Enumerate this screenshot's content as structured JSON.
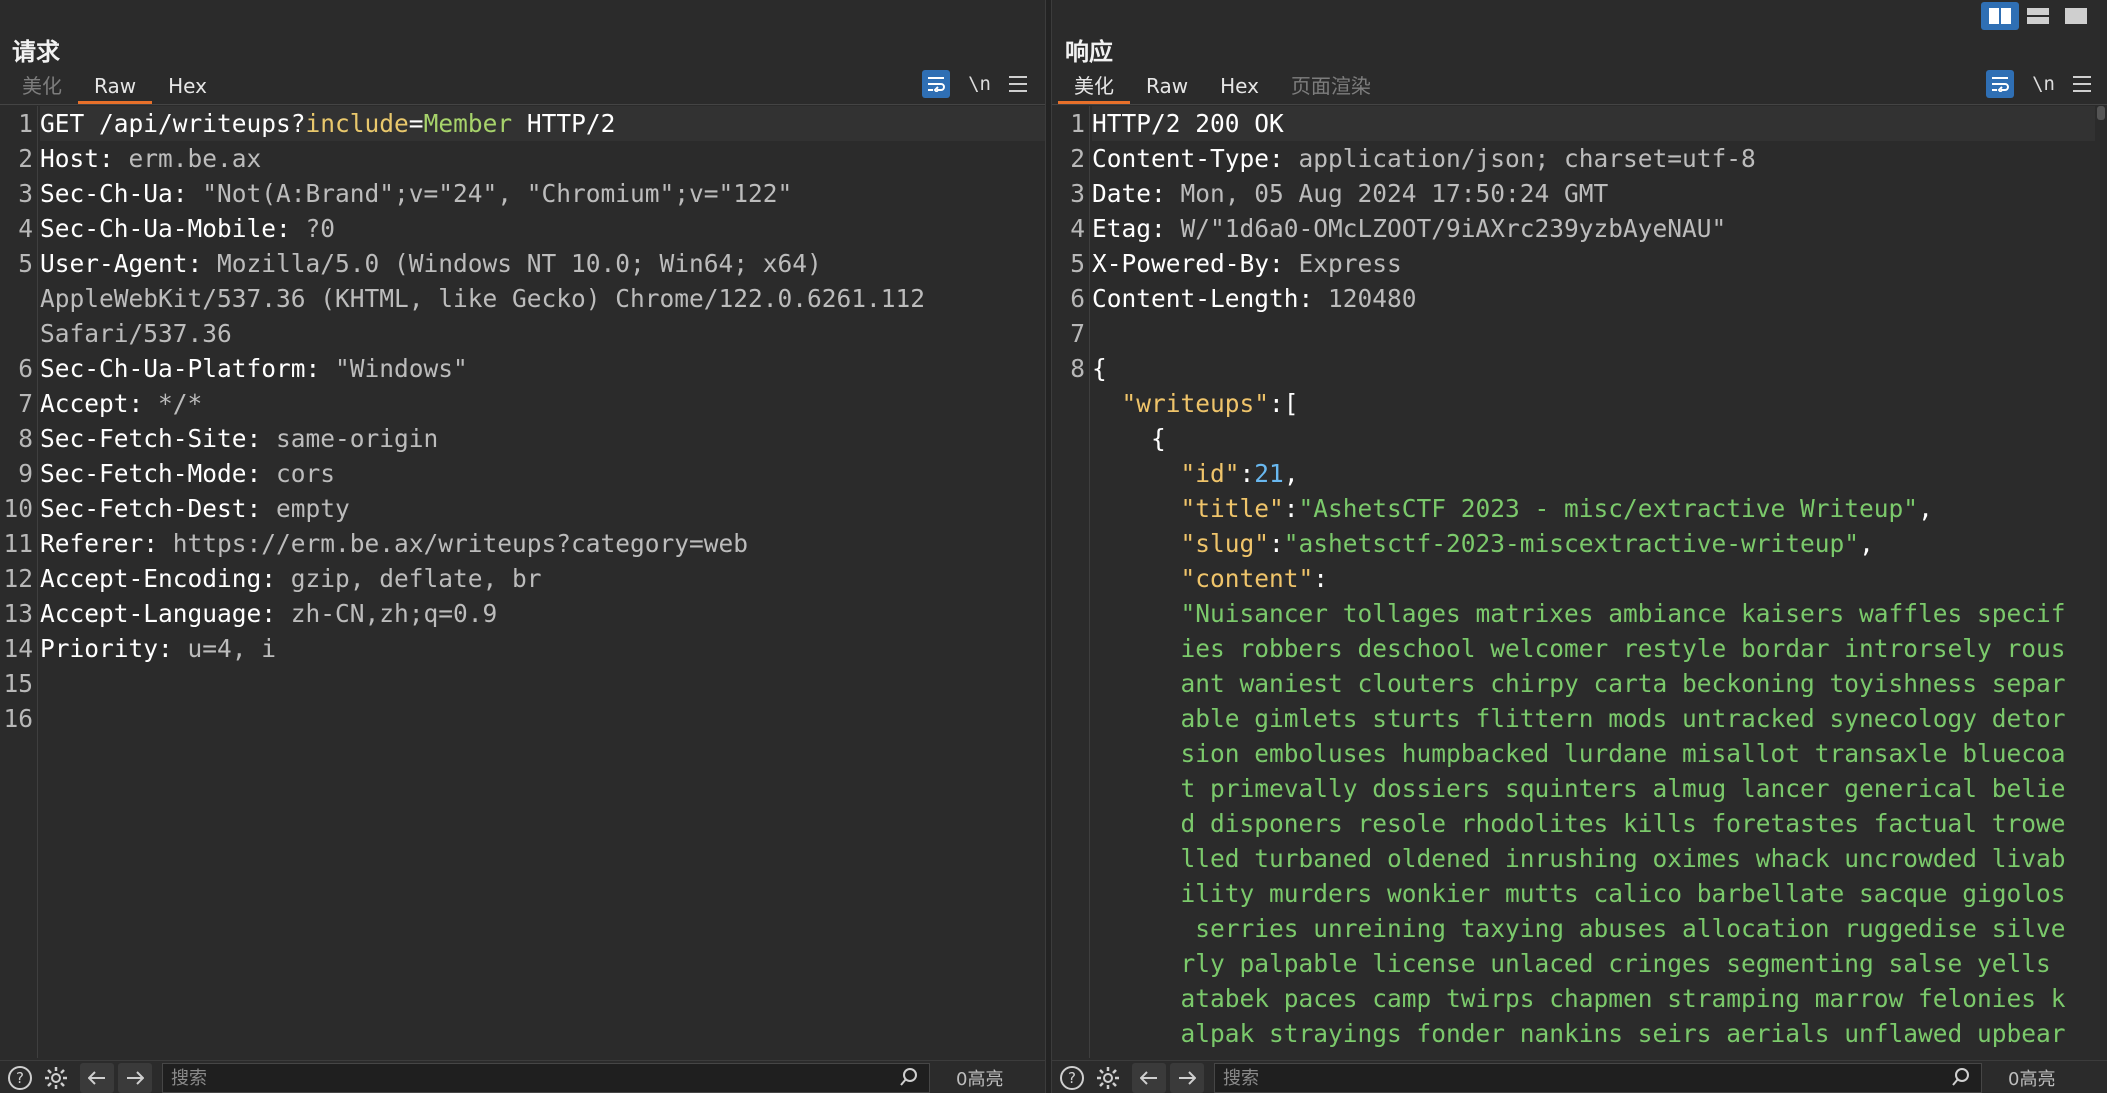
{
  "request": {
    "title": "请求",
    "tabs": [
      "美化",
      "Raw",
      "Hex"
    ],
    "active_tab": "Raw",
    "newline_toggle": "\\n",
    "lines": [
      {
        "n": "1",
        "parts": [
          [
            "k",
            "GET "
          ],
          [
            "k",
            "/api/writeups?"
          ],
          [
            "p",
            "include"
          ],
          [
            "k",
            "="
          ],
          [
            "g",
            "Member"
          ],
          [
            "k",
            " HTTP/2"
          ]
        ]
      },
      {
        "n": "2",
        "parts": [
          [
            "k",
            "Host: "
          ],
          [
            "v",
            "erm.be.ax"
          ]
        ]
      },
      {
        "n": "3",
        "parts": [
          [
            "k",
            "Sec-Ch-Ua: "
          ],
          [
            "v",
            "\"Not(A:Brand\";v=\"24\", \"Chromium\";v=\"122\""
          ]
        ]
      },
      {
        "n": "4",
        "parts": [
          [
            "k",
            "Sec-Ch-Ua-Mobile: "
          ],
          [
            "v",
            "?0"
          ]
        ]
      },
      {
        "n": "5",
        "parts": [
          [
            "k",
            "User-Agent: "
          ],
          [
            "v",
            "Mozilla/5.0 (Windows NT 10.0; Win64; x64)"
          ]
        ]
      },
      {
        "n": "",
        "parts": [
          [
            "v",
            "AppleWebKit/537.36 (KHTML, like Gecko) Chrome/122.0.6261.112"
          ]
        ]
      },
      {
        "n": "",
        "parts": [
          [
            "v",
            "Safari/537.36"
          ]
        ]
      },
      {
        "n": "6",
        "parts": [
          [
            "k",
            "Sec-Ch-Ua-Platform: "
          ],
          [
            "v",
            "\"Windows\""
          ]
        ]
      },
      {
        "n": "7",
        "parts": [
          [
            "k",
            "Accept: "
          ],
          [
            "v",
            "*/*"
          ]
        ]
      },
      {
        "n": "8",
        "parts": [
          [
            "k",
            "Sec-Fetch-Site: "
          ],
          [
            "v",
            "same-origin"
          ]
        ]
      },
      {
        "n": "9",
        "parts": [
          [
            "k",
            "Sec-Fetch-Mode: "
          ],
          [
            "v",
            "cors"
          ]
        ]
      },
      {
        "n": "10",
        "parts": [
          [
            "k",
            "Sec-Fetch-Dest: "
          ],
          [
            "v",
            "empty"
          ]
        ]
      },
      {
        "n": "11",
        "parts": [
          [
            "k",
            "Referer: "
          ],
          [
            "v",
            "https://erm.be.ax/writeups?category=web"
          ]
        ]
      },
      {
        "n": "12",
        "parts": [
          [
            "k",
            "Accept-Encoding: "
          ],
          [
            "v",
            "gzip, deflate, br"
          ]
        ]
      },
      {
        "n": "13",
        "parts": [
          [
            "k",
            "Accept-Language: "
          ],
          [
            "v",
            "zh-CN,zh;q=0.9"
          ]
        ]
      },
      {
        "n": "14",
        "parts": [
          [
            "k",
            "Priority: "
          ],
          [
            "v",
            "u=4, i"
          ]
        ]
      },
      {
        "n": "15",
        "parts": []
      },
      {
        "n": "16",
        "parts": []
      }
    ],
    "search_placeholder": "搜索",
    "highlight_count": "0高亮"
  },
  "response": {
    "title": "响应",
    "tabs": [
      "美化",
      "Raw",
      "Hex",
      "页面渲染"
    ],
    "active_tab": "美化",
    "newline_toggle": "\\n",
    "lines": [
      {
        "n": "1",
        "parts": [
          [
            "k",
            "HTTP/2 200 OK"
          ]
        ]
      },
      {
        "n": "2",
        "parts": [
          [
            "k",
            "Content-Type: "
          ],
          [
            "v",
            "application/json; charset=utf-8"
          ]
        ]
      },
      {
        "n": "3",
        "parts": [
          [
            "k",
            "Date: "
          ],
          [
            "v",
            "Mon, 05 Aug 2024 17:50:24 GMT"
          ]
        ]
      },
      {
        "n": "4",
        "parts": [
          [
            "k",
            "Etag: "
          ],
          [
            "v",
            "W/\"1d6a0-OMcLZOOT/9iAXrc239yzbAyeNAU\""
          ]
        ]
      },
      {
        "n": "5",
        "parts": [
          [
            "k",
            "X-Powered-By: "
          ],
          [
            "v",
            "Express"
          ]
        ]
      },
      {
        "n": "6",
        "parts": [
          [
            "k",
            "Content-Length: "
          ],
          [
            "v",
            "120480"
          ]
        ]
      },
      {
        "n": "7",
        "parts": []
      },
      {
        "n": "8",
        "parts": [
          [
            "k",
            "{"
          ]
        ]
      },
      {
        "n": "",
        "parts": [
          [
            "k",
            "  "
          ],
          [
            "jkey",
            "\"writeups\""
          ],
          [
            "k",
            ":["
          ]
        ]
      },
      {
        "n": "",
        "parts": [
          [
            "k",
            "    {"
          ]
        ]
      },
      {
        "n": "",
        "parts": [
          [
            "k",
            "      "
          ],
          [
            "jkey",
            "\"id\""
          ],
          [
            "k",
            ":"
          ],
          [
            "jnum",
            "21"
          ],
          [
            "k",
            ","
          ]
        ]
      },
      {
        "n": "",
        "parts": [
          [
            "k",
            "      "
          ],
          [
            "jkey",
            "\"title\""
          ],
          [
            "k",
            ":"
          ],
          [
            "jstr",
            "\"AshetsCTF 2023 - misc/extractive Writeup\""
          ],
          [
            "k",
            ","
          ]
        ]
      },
      {
        "n": "",
        "parts": [
          [
            "k",
            "      "
          ],
          [
            "jkey",
            "\"slug\""
          ],
          [
            "k",
            ":"
          ],
          [
            "jstr",
            "\"ashetsctf-2023-miscextractive-writeup\""
          ],
          [
            "k",
            ","
          ]
        ]
      },
      {
        "n": "",
        "parts": [
          [
            "k",
            "      "
          ],
          [
            "jkey",
            "\"content\""
          ],
          [
            "k",
            ":"
          ]
        ]
      },
      {
        "n": "",
        "parts": [
          [
            "k",
            "      "
          ],
          [
            "jstr",
            "\"Nuisancer tollages matrixes ambiance kaisers waffles specif"
          ]
        ]
      },
      {
        "n": "",
        "parts": [
          [
            "k",
            "      "
          ],
          [
            "jstr",
            "ies robbers deschool welcomer restyle bordar introrsely rous"
          ]
        ]
      },
      {
        "n": "",
        "parts": [
          [
            "k",
            "      "
          ],
          [
            "jstr",
            "ant waniest clouters chirpy carta beckoning toyishness separ"
          ]
        ]
      },
      {
        "n": "",
        "parts": [
          [
            "k",
            "      "
          ],
          [
            "jstr",
            "able gimlets sturts flittern mods untracked synecology detor"
          ]
        ]
      },
      {
        "n": "",
        "parts": [
          [
            "k",
            "      "
          ],
          [
            "jstr",
            "sion emboluses humpbacked lurdane misallot transaxle bluecoa"
          ]
        ]
      },
      {
        "n": "",
        "parts": [
          [
            "k",
            "      "
          ],
          [
            "jstr",
            "t primevally dossiers squinters almug lancer generical belie"
          ]
        ]
      },
      {
        "n": "",
        "parts": [
          [
            "k",
            "      "
          ],
          [
            "jstr",
            "d disponers resole rhodolites kills foretastes factual trowe"
          ]
        ]
      },
      {
        "n": "",
        "parts": [
          [
            "k",
            "      "
          ],
          [
            "jstr",
            "lled turbaned oldened inrushing oximes whack uncrowded livab"
          ]
        ]
      },
      {
        "n": "",
        "parts": [
          [
            "k",
            "      "
          ],
          [
            "jstr",
            "ility murders wonkier mutts calico barbellate sacque gigolos"
          ]
        ]
      },
      {
        "n": "",
        "parts": [
          [
            "k",
            "      "
          ],
          [
            "jstr",
            " serries unreining taxying abuses allocation ruggedise silve"
          ]
        ]
      },
      {
        "n": "",
        "parts": [
          [
            "k",
            "      "
          ],
          [
            "jstr",
            "rly palpable license unlaced cringes segmenting salse yells"
          ]
        ]
      },
      {
        "n": "",
        "parts": [
          [
            "k",
            "      "
          ],
          [
            "jstr",
            "atabek paces camp twirps chapmen stramping marrow felonies k"
          ]
        ]
      },
      {
        "n": "",
        "parts": [
          [
            "k",
            "      "
          ],
          [
            "jstr",
            "alpak strayings fonder nankins seirs aerials unflawed upbear"
          ]
        ]
      }
    ],
    "search_placeholder": "搜索",
    "highlight_count": "0高亮"
  },
  "icons": {
    "wrap": "word-wrap-icon",
    "menu": "hamburger-menu-icon",
    "help": "help-icon",
    "settings": "gear-icon",
    "back": "arrow-left-icon",
    "forward": "arrow-right-icon",
    "search": "search-icon",
    "layout_side_by_side": "layout-columns-icon",
    "layout_stacked": "layout-rows-icon",
    "layout_single": "layout-single-icon"
  },
  "colors": {
    "accent_tab": "#e8702a",
    "active_button": "#2f6fb4",
    "json_key": "#efc46a",
    "json_string": "#7bc96b",
    "json_number": "#69b8f0"
  }
}
